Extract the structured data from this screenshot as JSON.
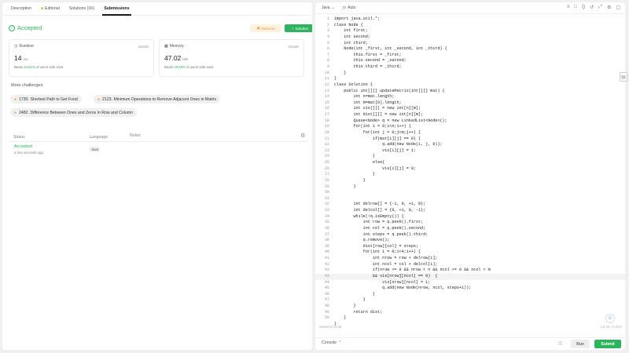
{
  "tabs": [
    {
      "label": "Description"
    },
    {
      "label": "Editorial"
    },
    {
      "label": "Solutions (1K)"
    },
    {
      "label": "Submissions"
    }
  ],
  "result": {
    "status": "Accepted",
    "editorial_label": "Editorial",
    "solution_label": "Solution"
  },
  "runtime": {
    "label": "Runtime",
    "details": "Details",
    "value": "14",
    "unit": "ms",
    "beats_prefix": "Beats",
    "beats_pct": "64.81%",
    "beats_suffix": "of users with Java"
  },
  "memory": {
    "label": "Memory",
    "details": "Details",
    "value": "47.02",
    "unit": "MB",
    "beats_prefix": "Beats",
    "beats_pct": "49.58%",
    "beats_suffix": "of users with Java"
  },
  "more_challenges": {
    "title": "More challenges",
    "items": [
      "1730. Shortest Path to Get Food",
      "2123. Minimum Operations to Remove Adjacent Ones in Matrix",
      "2482. Difference Between Ones and Zeros in Row and Column"
    ]
  },
  "submissions": {
    "headers": {
      "status": "Status",
      "language": "Language",
      "notes": "Notes"
    },
    "rows": [
      {
        "status": "Accepted",
        "time": "a few seconds ago",
        "language": "Java"
      }
    ]
  },
  "editor": {
    "language": "Java",
    "autocomplete": "Auto",
    "saved_text": "Saved to local",
    "cursor_pos": "Ln 42, Col 57",
    "code": [
      "import java.util.*;",
      "class Node {",
      "    int first;",
      "    int second;",
      "    int third;",
      "    Node(int _first, int _second, int _third) {",
      "        this.first = _first;",
      "        this.second = _second;",
      "        this.third = _third;",
      "    }",
      "}",
      "class Solution {",
      "    public int[][] updateMatrix(int[][] mat) {",
      "        int n=mat.length;",
      "        int m=mat[0].length;",
      "        int vis[][] = new int[n][m];",
      "        int dist[][] = new int[n][m];",
      "        Queue<Node> q = new LinkedList<Node>();",
      "        for(int i = 0;i<n;i++) {",
      "            for(int j = 0;j<m;j++) {",
      "                if(mat[i][j] == 0) {",
      "                    q.add(new Node(i, j, 0));",
      "                    vis[i][j] = 1;",
      "                }",
      "                else{",
      "                    vis[i][j] = 0;",
      "                }",
      "            }",
      "        }",
      "",
      "",
      "        int delrow[] = {-1, 0, +1, 0};",
      "        int delcol[] = {0, +1, 0, -1};",
      "        while(!q.isEmpty()) {",
      "            int row = q.peek().first;",
      "            int col = q.peek().second;",
      "            int steps = q.peek().third;",
      "            q.remove();",
      "            dist[row][col] = steps;",
      "            for(int i = 0;i<4;i++) {",
      "                int nrow = row + delrow[i];",
      "                int ncol = col + delcol[i];",
      "                if(nrow >= 0 && nrow < n && ncol >= 0 && ncol < m",
      "                && vis[nrow][ncol] == 0)  {",
      "                    vis[nrow][ncol] = 1;",
      "                    q.add(new Node(nrow, ncol, steps+1));",
      "                }",
      "            }",
      "        }",
      "        return dist;",
      "    }",
      "}"
    ],
    "line_numbers": [
      "1",
      "2",
      "3",
      "4",
      "5",
      "6",
      "7",
      "8",
      "9",
      "10",
      "11",
      "12",
      "13",
      "14",
      "15",
      "16",
      "17",
      "18",
      "19",
      "20",
      "21",
      "22",
      "23",
      "24",
      "25",
      "26",
      "27",
      "28",
      "29",
      "30",
      "31",
      "32",
      "33",
      "34",
      "35",
      "36",
      "37",
      "38",
      "39",
      "40",
      "41",
      "42",
      "42",
      "43",
      "44",
      "45",
      "46",
      "47",
      "48",
      "49",
      "50"
    ]
  },
  "bottom": {
    "console_label": "Console",
    "run_label": "Run",
    "submit_label": "Submit"
  }
}
